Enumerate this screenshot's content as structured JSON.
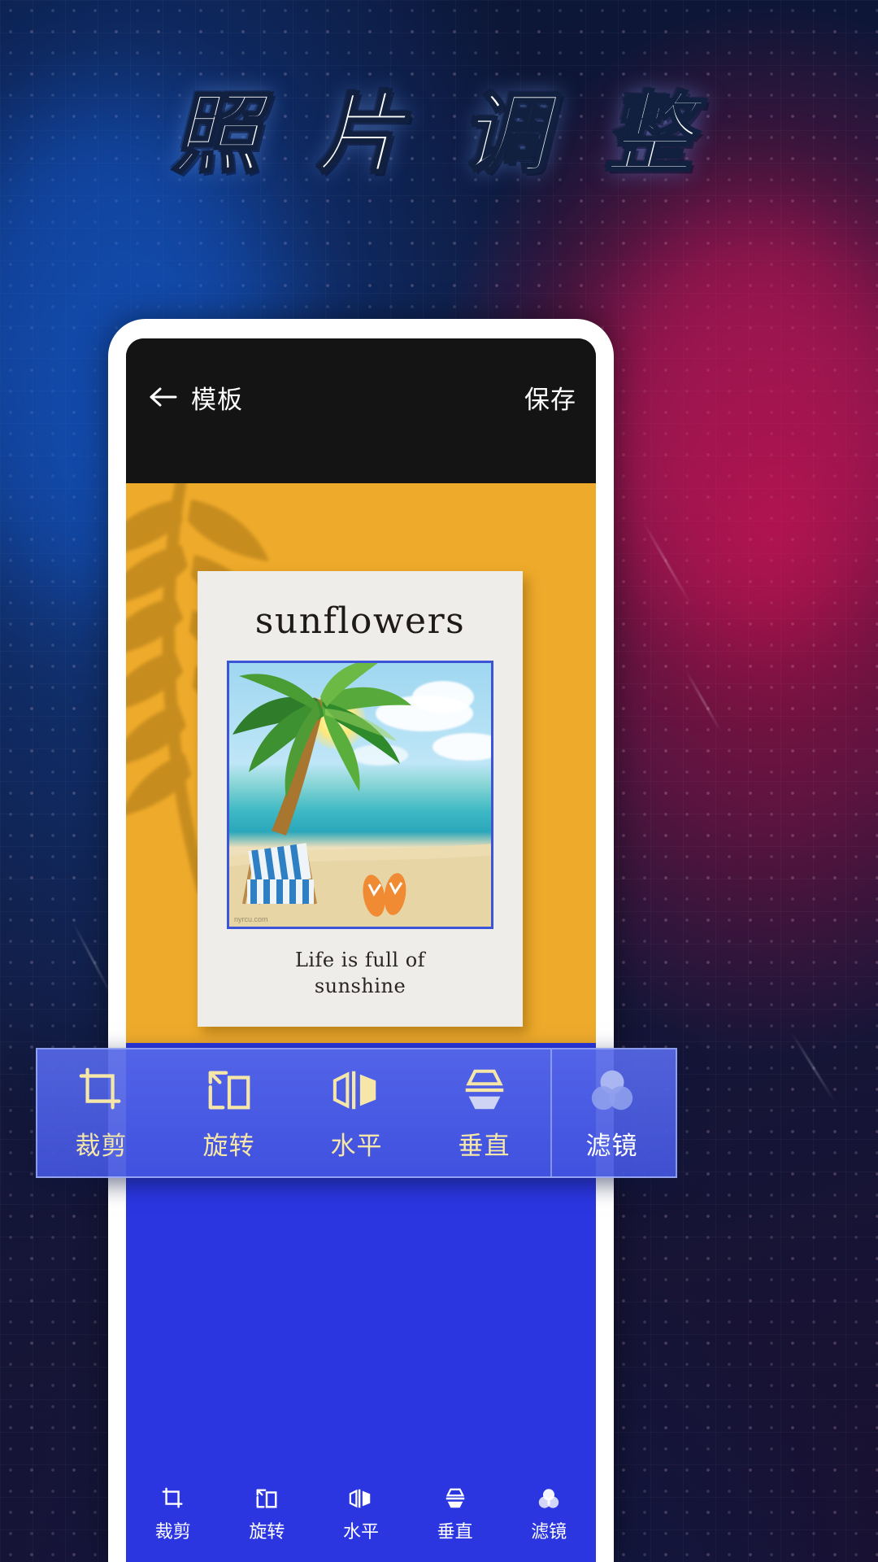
{
  "poster_headline": "照 片 调 整",
  "app": {
    "appbar": {
      "back_icon": "arrow-left-icon",
      "title": "模板",
      "save_label": "保存"
    },
    "canvas": {
      "background_color": "#eeaa2a",
      "poster": {
        "title": "sunflowers",
        "subtitle": "Life is full of\nsunshine",
        "subtitle_line1": "Life is full of",
        "subtitle_line2": "sunshine",
        "photo_watermark": "nyrcu.com",
        "photo_border_color": "#3c54d8"
      }
    },
    "toolbar": {
      "items": [
        {
          "label": "裁剪",
          "icon": "crop-icon"
        },
        {
          "label": "旋转",
          "icon": "rotate-icon"
        },
        {
          "label": "水平",
          "icon": "flip-horizontal-icon"
        },
        {
          "label": "垂直",
          "icon": "flip-vertical-icon"
        },
        {
          "label": "滤镜",
          "icon": "filter-circles-icon"
        }
      ]
    }
  },
  "colors": {
    "toolbar_blue": "#2b36e0",
    "overlay_blue": "#5668e8",
    "overlay_label_gold": "#f6e7a8",
    "appbar_black": "#141414",
    "canvas_orange": "#eeaa2a"
  }
}
